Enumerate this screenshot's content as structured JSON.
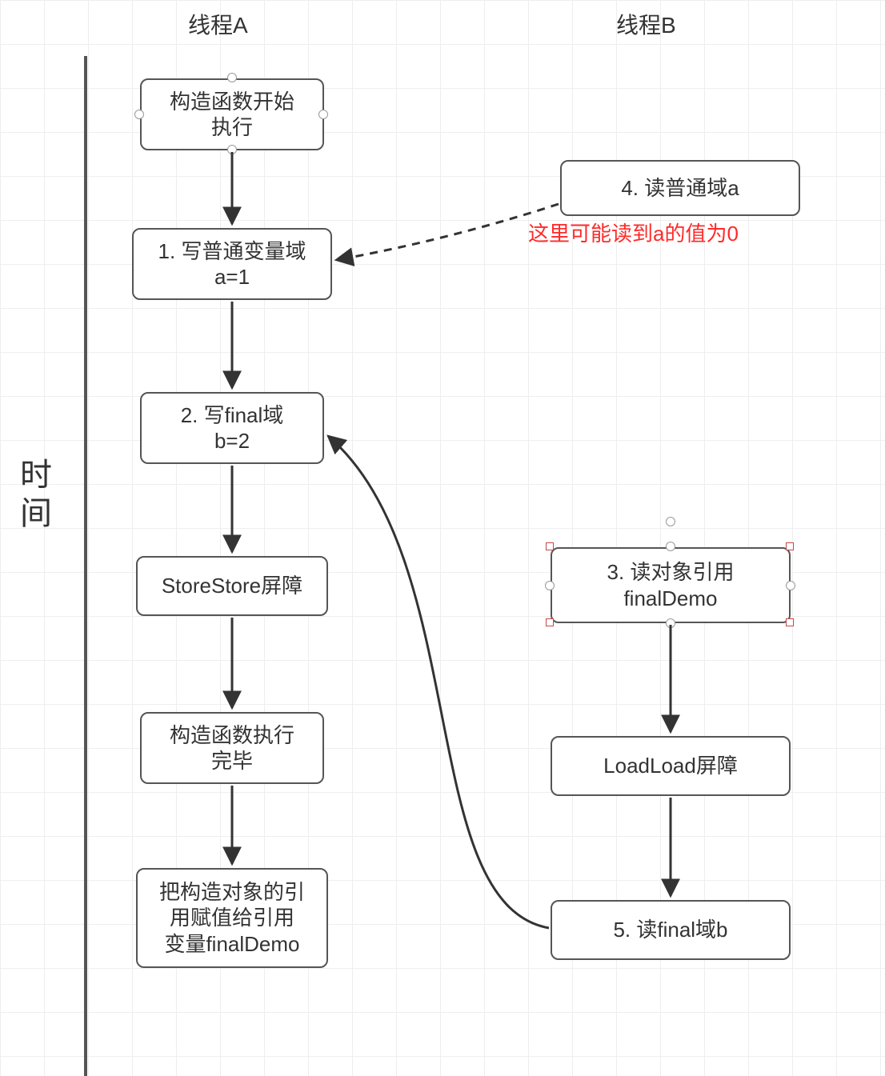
{
  "headers": {
    "threadA": "线程A",
    "threadB": "线程B",
    "timeAxis": "时\n间"
  },
  "threadA": {
    "n1": "构造函数开始\n执行",
    "n2": "1. 写普通变量域\na=1",
    "n3": "2. 写final域\nb=2",
    "n4": "StoreStore屏障",
    "n5": "构造函数执行\n完毕",
    "n6": "把构造对象的引\n用赋值给引用\n变量finalDemo"
  },
  "threadB": {
    "b1": "4. 读普通域a",
    "b1_note": "这里可能读到a的值为0",
    "b2": "3. 读对象引用\nfinalDemo",
    "b3": "LoadLoad屏障",
    "b4": "5. 读final域b"
  }
}
